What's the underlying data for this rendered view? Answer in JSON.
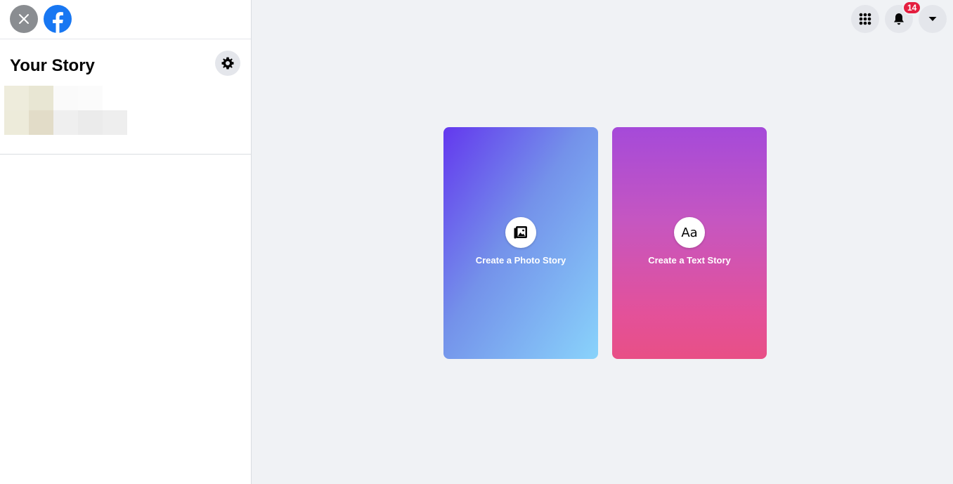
{
  "sidebar": {
    "title": "Your Story"
  },
  "header": {
    "notification_count": "14"
  },
  "cards": {
    "photo_label": "Create a Photo Story",
    "text_label": "Create a Text Story",
    "text_icon_glyph": "Aa"
  },
  "colors": {
    "brand": "#1877f2",
    "badge": "#e41e3f",
    "photo_gradient": [
      "#6338ee",
      "#7492ea",
      "#89d3fb"
    ],
    "text_gradient": [
      "#a54ad9",
      "#c556c1",
      "#e84f86"
    ]
  },
  "icons": [
    "close-icon",
    "facebook-logo-icon",
    "gear-icon",
    "menu-grid-icon",
    "bell-icon",
    "caret-down-icon",
    "photo-icon"
  ]
}
